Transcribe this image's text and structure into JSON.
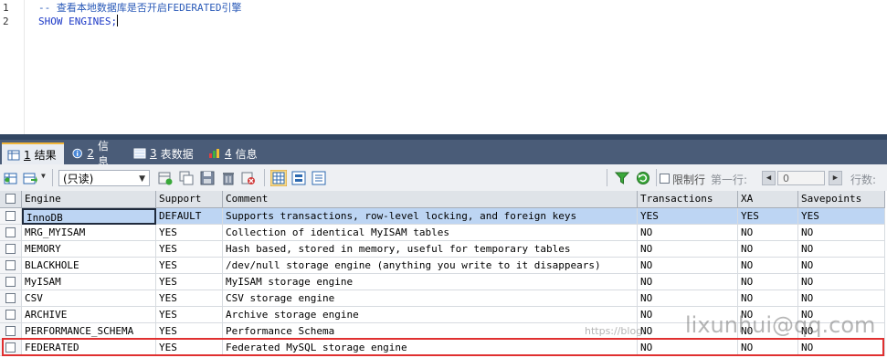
{
  "editor": {
    "line_numbers": [
      "1",
      "2"
    ],
    "lines": [
      "-- 查看本地数据库是否开启FEDERATED引擎",
      "SHOW ENGINES;"
    ]
  },
  "tabs": [
    {
      "num": "1",
      "label": "结果",
      "icon": "result-table-icon"
    },
    {
      "num": "2",
      "label": "信息",
      "icon": "info-icon"
    },
    {
      "num": "3",
      "label": "表数据",
      "icon": "table-data-icon"
    },
    {
      "num": "4",
      "label": "信息",
      "icon": "info-chart-icon"
    }
  ],
  "toolbar": {
    "mode_select": "(只读)",
    "limit_rows_label": "限制行",
    "first_row_label": "第一行:",
    "first_row_value": "0",
    "rows_label": "行数:"
  },
  "grid": {
    "columns": [
      "Engine",
      "Support",
      "Comment",
      "Transactions",
      "XA",
      "Savepoints"
    ],
    "rows": [
      [
        "InnoDB",
        "DEFAULT",
        "Supports transactions, row-level locking, and foreign keys",
        "YES",
        "YES",
        "YES"
      ],
      [
        "MRG_MYISAM",
        "YES",
        "Collection of identical MyISAM tables",
        "NO",
        "NO",
        "NO"
      ],
      [
        "MEMORY",
        "YES",
        "Hash based, stored in memory, useful for temporary tables",
        "NO",
        "NO",
        "NO"
      ],
      [
        "BLACKHOLE",
        "YES",
        "/dev/null storage engine (anything you write to it disappears)",
        "NO",
        "NO",
        "NO"
      ],
      [
        "MyISAM",
        "YES",
        "MyISAM storage engine",
        "NO",
        "NO",
        "NO"
      ],
      [
        "CSV",
        "YES",
        "CSV storage engine",
        "NO",
        "NO",
        "NO"
      ],
      [
        "ARCHIVE",
        "YES",
        "Archive storage engine",
        "NO",
        "NO",
        "NO"
      ],
      [
        "PERFORMANCE_SCHEMA",
        "YES",
        "Performance Schema",
        "NO",
        "NO",
        "NO"
      ],
      [
        "FEDERATED",
        "YES",
        "Federated MySQL storage engine",
        "NO",
        "NO",
        "NO"
      ]
    ]
  },
  "watermark": {
    "small": "https://blog.",
    "large": "lixunhui@qq.com"
  }
}
